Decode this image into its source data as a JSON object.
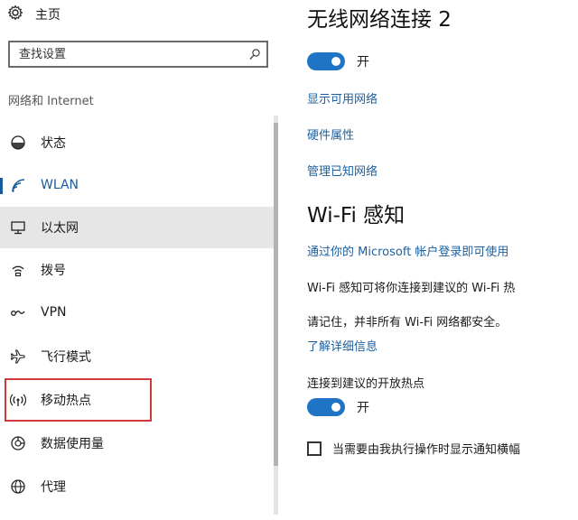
{
  "sidebar": {
    "home_label": "主页",
    "search_placeholder": "查找设置",
    "section_heading": "网络和 Internet",
    "items": [
      {
        "label": "状态",
        "icon": "home-status-icon"
      },
      {
        "label": "WLAN",
        "icon": "wifi-icon"
      },
      {
        "label": "以太网",
        "icon": "monitor-icon"
      },
      {
        "label": "拨号",
        "icon": "dialup-icon"
      },
      {
        "label": "VPN",
        "icon": "vpn-icon"
      },
      {
        "label": "飞行模式",
        "icon": "airplane-icon"
      },
      {
        "label": "移动热点",
        "icon": "hotspot-icon"
      },
      {
        "label": "数据使用量",
        "icon": "data-usage-icon"
      },
      {
        "label": "代理",
        "icon": "globe-icon"
      }
    ],
    "selected_item": "WLAN",
    "hover_item": "以太网",
    "highlighted_item": "移动热点"
  },
  "main": {
    "title": "无线网络连接 2",
    "wifi_toggle_label": "开",
    "links": {
      "show_networks": "显示可用网络",
      "hardware_properties": "硬件属性",
      "manage_known": "管理已知网络"
    },
    "sense_title": "Wi-Fi 感知",
    "sense_link": "通过你的 Microsoft 帐户登录即可使用",
    "sense_desc": "Wi-Fi 感知可将你连接到建议的 Wi-Fi 热",
    "sense_warning": "请记住，并非所有 Wi-Fi 网络都安全。",
    "learn_more": "了解详细信息",
    "hotspot_setting_label": "连接到建议的开放热点",
    "hotspot_toggle_label": "开",
    "notify_checkbox_label": "当需要由我执行操作时显示通知横幅"
  },
  "colors": {
    "accent": "#1f74c6",
    "link": "#1c5f9e",
    "highlight": "#d0383a"
  }
}
